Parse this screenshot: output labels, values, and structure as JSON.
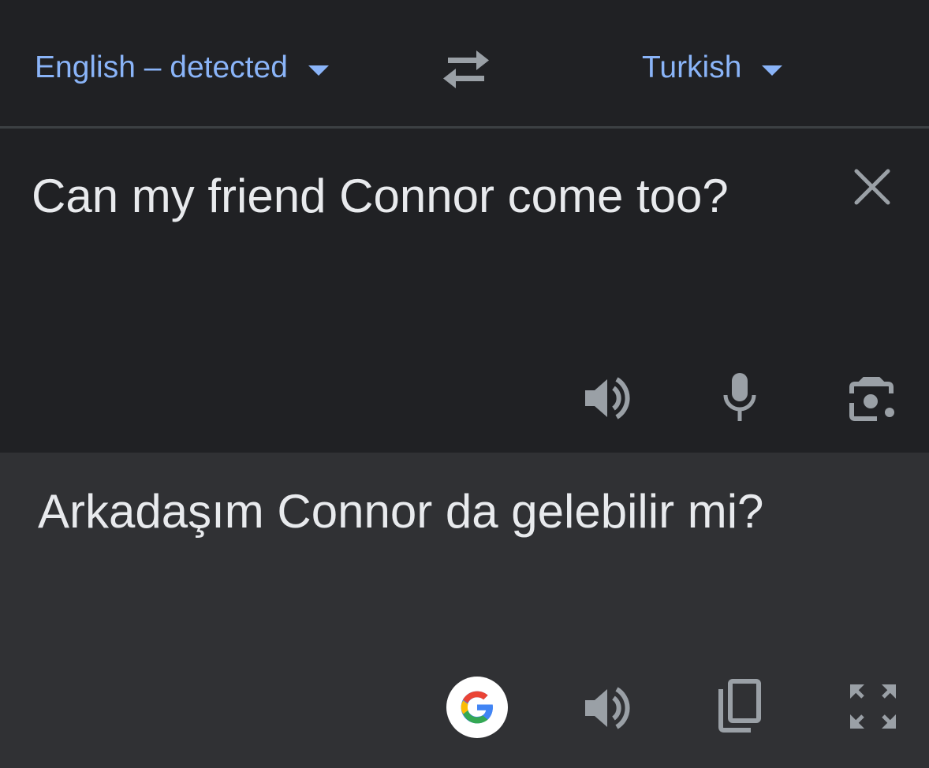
{
  "languages": {
    "source_label": "English – detected",
    "target_label": "Turkish"
  },
  "source": {
    "text": "Can my friend Connor come too?",
    "icons": [
      "close-icon",
      "speaker-icon",
      "microphone-icon",
      "camera-icon"
    ]
  },
  "translation": {
    "text": "Arkadaşım Connor da gelebilir mi?",
    "icons": [
      "google-logo-icon",
      "speaker-icon",
      "copy-icon",
      "fullscreen-icon"
    ]
  },
  "colors": {
    "background": "#202124",
    "translation_background": "#303134",
    "accent": "#8ab4f8",
    "text": "#e8eaed",
    "icon": "#9aa0a6"
  }
}
